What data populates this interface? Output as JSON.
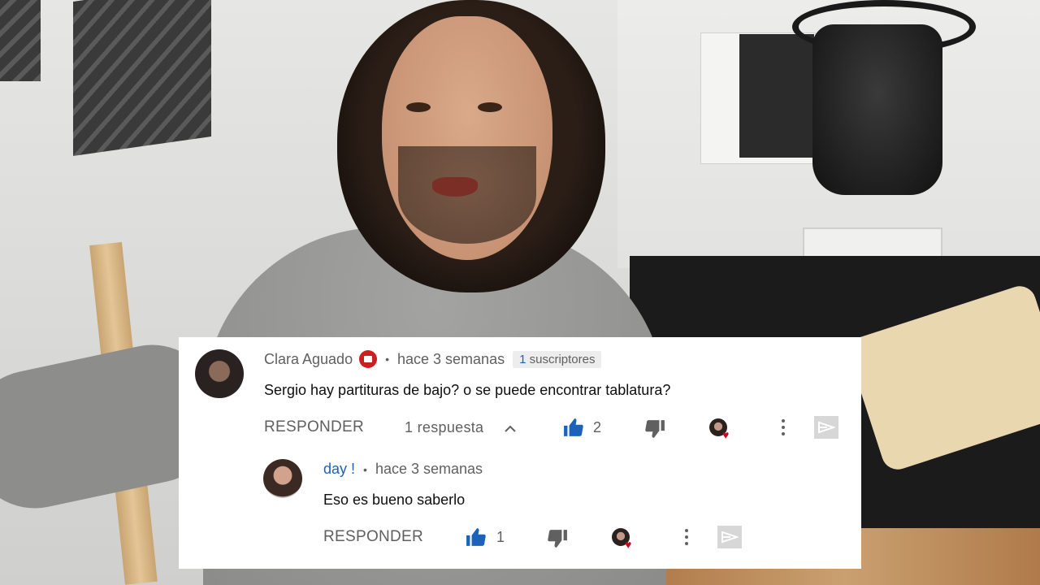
{
  "comment": {
    "author": "Clara Aguado",
    "time": "hace 3 semanas",
    "subs_count": "1",
    "subs_label": "suscriptores",
    "text": "Sergio hay partituras de bajo? o se puede encontrar tablatura?",
    "reply_label": "RESPONDER",
    "replies_label": "1 respuesta",
    "likes": "2"
  },
  "reply": {
    "author": "day !",
    "time": "hace 3 semanas",
    "text": "Eso es bueno saberlo",
    "reply_label": "RESPONDER",
    "likes": "1"
  },
  "colors": {
    "like_blue": "#1c62b9",
    "heart_red": "#d0021b",
    "badge_red": "#cc1f1f"
  },
  "icons": [
    "thumbs-up-icon",
    "thumbs-down-icon",
    "creator-heart-icon",
    "more-vert-icon",
    "share-icon",
    "chevron-up-icon",
    "red-badge-icon"
  ]
}
